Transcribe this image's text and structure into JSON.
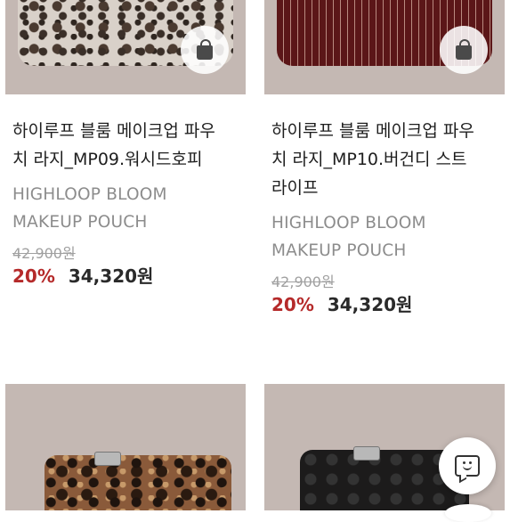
{
  "products": [
    {
      "title_line1": "하이루프 블룸 메이크업 파우",
      "title_line2": "치 라지_MP09.워시드호피",
      "eng_line1": "HIGHLOOP BLOOM",
      "eng_line2": "MAKEUP POUCH",
      "original_price": "42,900원",
      "discount": "20%",
      "price": "34,320원",
      "cart_icon": "shopping-bag-icon"
    },
    {
      "title_line1": "하이루프 블룸 메이크업 파우",
      "title_line2": "치 라지_MP10.버건디 스트",
      "title_line3": "라이프",
      "eng_line1": "HIGHLOOP BLOOM",
      "eng_line2": "MAKEUP POUCH",
      "original_price": "42,900원",
      "discount": "20%",
      "price": "34,320원",
      "cart_icon": "shopping-bag-icon"
    }
  ],
  "colors": {
    "discount": "#b52a2a",
    "price": "#2a2a2a",
    "title": "#1e1e1e",
    "subtitle": "#8c8c8c",
    "image_bg": "#c4b8b3"
  },
  "chat_button": {
    "icon": "chat-bubble-icon"
  }
}
